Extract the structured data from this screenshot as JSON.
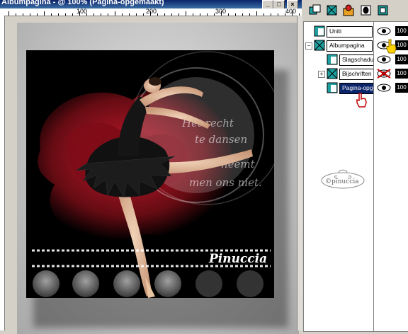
{
  "window": {
    "title": "Albumpagina - @ 100% (Pagina-opgemaakt)",
    "minimize_label": "_",
    "maximize_label": "□",
    "close_label": "×"
  },
  "ruler": {
    "labels": [
      "",
      "100",
      "200",
      "300",
      "400"
    ]
  },
  "artwork": {
    "signature": "Pinuccia",
    "poem_lines": [
      "Het recht",
      "te dansen",
      "neemt",
      "men ons niet."
    ]
  },
  "layers_panel": {
    "toolbar_icons": [
      "new-layer-icon",
      "new-group-icon",
      "layer-effects-icon",
      "mask-icon",
      "delete-layer-icon"
    ],
    "layers": [
      {
        "name": "Uniti",
        "opacity": "100",
        "visible": true,
        "icon": "layer-icon",
        "selected": false
      },
      {
        "name": "Albumpagina",
        "opacity": "100",
        "visible": true,
        "icon": "group-icon",
        "selected": false,
        "expanded": true
      },
      {
        "name": "Slagschaduw",
        "opacity": "100",
        "visible": true,
        "icon": "layer-icon",
        "selected": false
      },
      {
        "name": "Bijschriften",
        "opacity": "100",
        "visible": false,
        "icon": "group-icon",
        "selected": false,
        "expanded": false
      },
      {
        "name": "Pagina-opgemaakt",
        "opacity": "100",
        "visible": true,
        "icon": "layer-icon",
        "selected": true
      }
    ],
    "watermark": "©pinuccia"
  },
  "colors": {
    "selection": "#0a246a",
    "titlebar_start": "#0a246a",
    "titlebar_end": "#3a6ea5",
    "rose": "#8b0f1a"
  }
}
